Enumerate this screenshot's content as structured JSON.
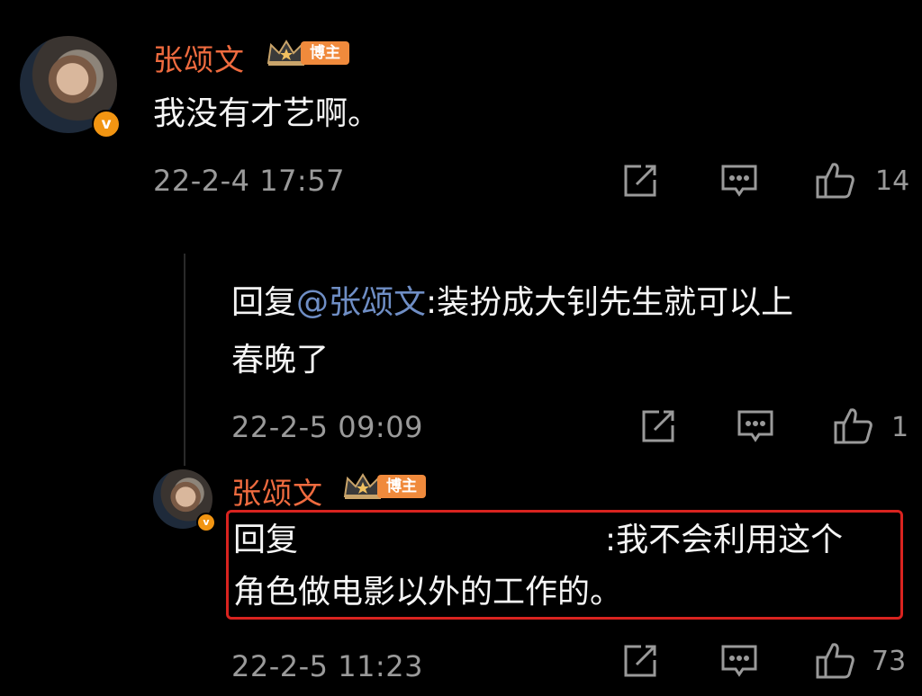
{
  "comments": [
    {
      "author": "张颂文",
      "badge": "博主",
      "text": "我没有才艺啊。",
      "time": "22-2-4 17:57",
      "likes": "14"
    },
    {
      "prefix": "回复",
      "mention": "@张颂文",
      "text_line1": ":装扮成大钊先生就可以上",
      "text_line2": "春晚了",
      "time": "22-2-5 09:09",
      "likes": "1"
    },
    {
      "author": "张颂文",
      "badge": "博主",
      "prefix": "回复",
      "text_line1": ":我不会利用这个",
      "text_line2": "角色做电影以外的工作的。",
      "time": "22-2-5 11:23",
      "likes": "73"
    }
  ],
  "colors": {
    "background": "#000000",
    "author_name": "#ef6b3f",
    "mention": "#6f8ec5",
    "badge": "#f08a3c",
    "highlight_border": "#d9231f",
    "meta_text": "#9a9a9a"
  },
  "icons": [
    "share-icon",
    "comment-icon",
    "like-icon",
    "crown-icon",
    "verified-v-icon"
  ]
}
